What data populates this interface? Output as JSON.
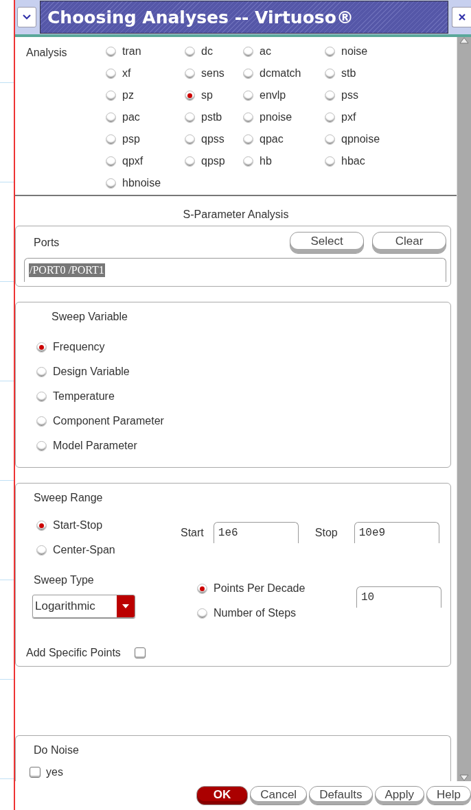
{
  "window": {
    "title": "Choosing Analyses -- Virtuoso®"
  },
  "analysis": {
    "label": "Analysis",
    "options": [
      {
        "label": "tran",
        "selected": false
      },
      {
        "label": "dc",
        "selected": false
      },
      {
        "label": "ac",
        "selected": false
      },
      {
        "label": "noise",
        "selected": false
      },
      {
        "label": "xf",
        "selected": false
      },
      {
        "label": "sens",
        "selected": false
      },
      {
        "label": "dcmatch",
        "selected": false
      },
      {
        "label": "stb",
        "selected": false
      },
      {
        "label": "pz",
        "selected": false
      },
      {
        "label": "sp",
        "selected": true
      },
      {
        "label": "envlp",
        "selected": false
      },
      {
        "label": "pss",
        "selected": false
      },
      {
        "label": "pac",
        "selected": false
      },
      {
        "label": "pstb",
        "selected": false
      },
      {
        "label": "pnoise",
        "selected": false
      },
      {
        "label": "pxf",
        "selected": false
      },
      {
        "label": "psp",
        "selected": false
      },
      {
        "label": "qpss",
        "selected": false
      },
      {
        "label": "qpac",
        "selected": false
      },
      {
        "label": "qpnoise",
        "selected": false
      },
      {
        "label": "qpxf",
        "selected": false
      },
      {
        "label": "qpsp",
        "selected": false
      },
      {
        "label": "hb",
        "selected": false
      },
      {
        "label": "hbac",
        "selected": false
      },
      {
        "label": "hbnoise",
        "selected": false
      }
    ]
  },
  "section_title": "S-Parameter Analysis",
  "ports": {
    "label": "Ports",
    "buttons": [
      "Select",
      "Clear"
    ],
    "value": "/PORT0 /PORT1"
  },
  "sweep_variable": {
    "label": "Sweep Variable",
    "options": [
      {
        "label": "Frequency",
        "selected": true
      },
      {
        "label": "Design Variable",
        "selected": false
      },
      {
        "label": "Temperature",
        "selected": false
      },
      {
        "label": "Component Parameter",
        "selected": false
      },
      {
        "label": "Model Parameter",
        "selected": false
      }
    ]
  },
  "sweep_range": {
    "label": "Sweep Range",
    "options": [
      {
        "label": "Start-Stop",
        "selected": true
      },
      {
        "label": "Center-Span",
        "selected": false
      }
    ],
    "start": {
      "label": "Start",
      "value": "1e6"
    },
    "stop": {
      "label": "Stop",
      "value": "10e9"
    },
    "sweep_type": {
      "label": "Sweep Type",
      "value": "Logarithmic",
      "options": [
        {
          "label": "Points Per Decade",
          "selected": true
        },
        {
          "label": "Number of Steps",
          "selected": false
        }
      ],
      "points": "10"
    },
    "add_specific_points": {
      "label": "Add Specific Points",
      "checked": false
    }
  },
  "do_noise": {
    "label": "Do Noise",
    "option": {
      "label": "yes",
      "checked": false
    }
  },
  "buttons": [
    {
      "label": "OK",
      "primary": true
    },
    {
      "label": "Cancel",
      "primary": false
    },
    {
      "label": "Defaults",
      "primary": false
    },
    {
      "label": "Apply",
      "primary": false
    },
    {
      "label": "Help",
      "primary": false
    }
  ]
}
